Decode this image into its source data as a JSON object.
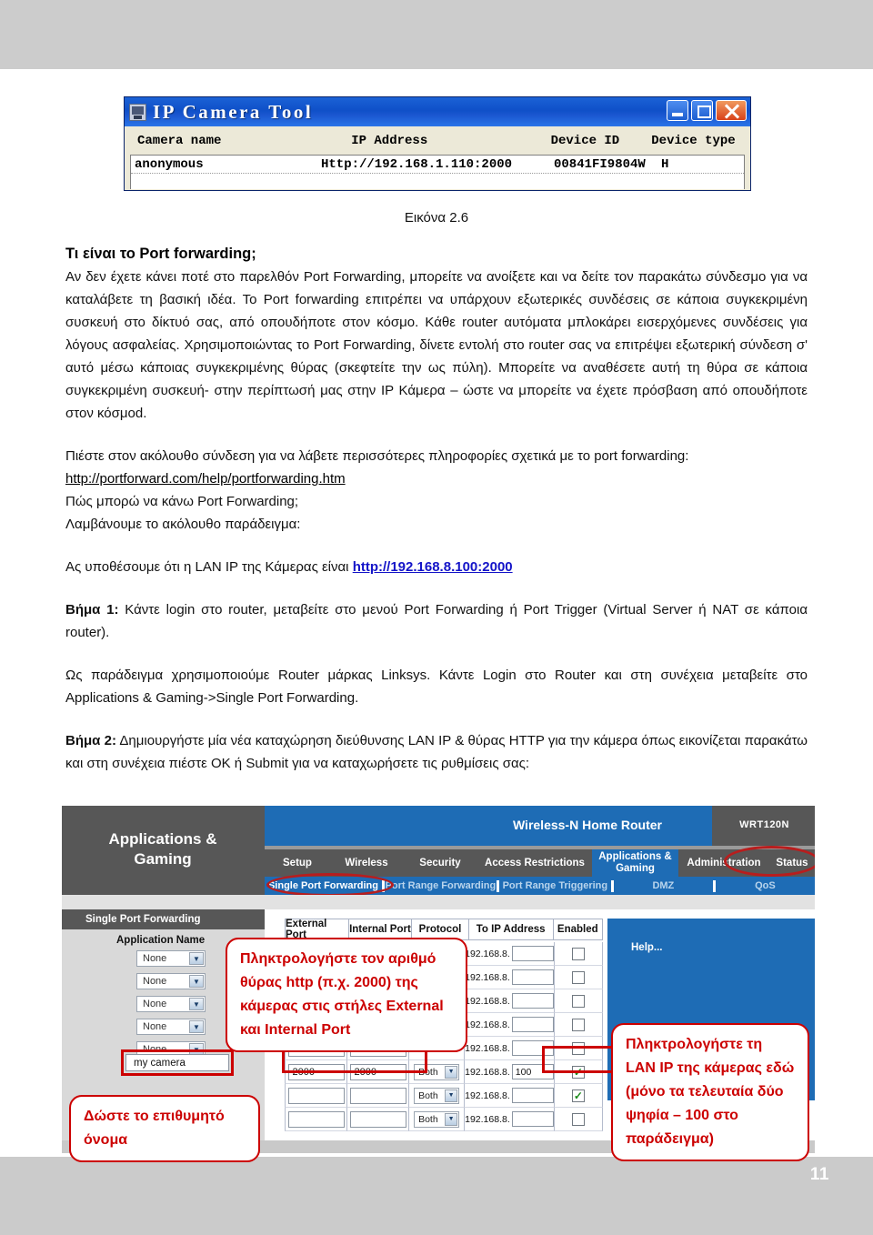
{
  "page": {
    "number": "11"
  },
  "ipcam_window": {
    "title": "IP Camera Tool",
    "app_icon": "camera-icon",
    "window_buttons": {
      "minimize": "minimize-icon",
      "maximize": "maximize-icon",
      "close": "close-icon"
    },
    "columns": [
      "Camera name",
      "IP Address",
      "Device ID",
      "Device type"
    ],
    "rows": [
      {
        "camera_name": "anonymous",
        "ip_address": "Http://192.168.1.110:2000",
        "device_id": "00841FI9804W",
        "device_type": "H"
      }
    ]
  },
  "caption": "Εικόνα 2.6",
  "body": {
    "heading": "Τι είναι το Port forwarding;",
    "paragraph1": "Αν δεν έχετε κάνει ποτέ στο παρελθόν Port Forwarding, μπορείτε να ανοίξετε και να δείτε τον παρακάτω σύνδεσμο για να καταλάβετε τη βασική ιδέα. Το Port forwarding επιτρέπει να υπάρχουν εξωτερικές συνδέσεις σε κάποια συγκεκριμένη συσκευή στο δίκτυό σας, από οπουδήποτε στον κόσμο. Κάθε router αυτόματα μπλοκάρει εισερχόμενες συνδέσεις για λόγους ασφαλείας. Χρησιμοποιώντας το Port Forwarding, δίνετε εντολή στο router σας να επιτρέψει εξωτερική σύνδεση σ' αυτό μέσω κάποιας συγκεκριμένης θύρας (σκεφτείτε την ως πύλη). Μπορείτε να αναθέσετε αυτή τη θύρα σε κάποια συγκεκριμένη συσκευή- στην περίπτωσή μας στην IP Κάμερα – ώστε να μπορείτε να έχετε πρόσβαση από οπουδήποτε στον κόσμοd.",
    "paragraph2": "Πιέστε στον ακόλουθο σύνδεση για να λάβετε περισσότερες πληροφορίες σχετικά με το port forwarding:",
    "link_portforward": "http://portforward.com/help/portforwarding.htm",
    "line_how": "Πώς μπορώ να κάνω Port Forwarding;",
    "line_example": "Λαμβάνουμε το ακόλουθο παράδειγμα:",
    "assume_prefix": "Ας υποθέσουμε ότι η LAN IP της Κάμερας είναι ",
    "assume_link": "http://192.168.8.100:2000",
    "step1_label": "Βήμα 1:",
    "step1_text": " Κάντε login στο router, μεταβείτε στο μενού Port Forwarding ή Port Trigger (Virtual Server ή NAT σε κάποια router).",
    "example_router": "Ως παράδειγμα χρησιμοποιούμε Router μάρκας Linksys. Κάντε Login στο Router και στη συνέχεια μεταβείτε στο Applications & Gaming->Single Port Forwarding.",
    "step2_label": "Βήμα 2:",
    "step2_text": " Δημιουργήστε μία νέα καταχώρηση διεύθυνσης LAN IP & θύρας HTTP για την κάμερα όπως εικονίζεται παρακάτω και στη συνέχεια πιέστε OK ή Submit για να καταχωρήσετε τις ρυθμίσεις σας:"
  },
  "router": {
    "section_title": "Applications &\nGaming",
    "section_title_line1": "Applications &",
    "section_title_line2": "Gaming",
    "brand_name": "Wireless-N Home Router",
    "model": "WRT120N",
    "nav": [
      "Setup",
      "Wireless",
      "Security",
      "Access Restrictions",
      "Applications & Gaming",
      "Administration",
      "Status"
    ],
    "nav_active_line1": "Applications &",
    "nav_active_line2": "Gaming",
    "subnav": [
      "Single Port Forwarding",
      "Port Range Forwarding",
      "Port Range Triggering",
      "DMZ",
      "QoS"
    ],
    "left_panel_title": "Single Port Forwarding",
    "application_name_label": "Application Name",
    "select_options": [
      "None",
      "None",
      "None",
      "None",
      "None"
    ],
    "application_name_value": "my camera",
    "help_label": "Help...",
    "table": {
      "headers": [
        "External Port",
        "Internal Port",
        "Protocol",
        "To IP Address",
        "Enabled"
      ],
      "ip_prefix": "192.168.8.",
      "rows": [
        {
          "external": "",
          "internal": "",
          "protocol": "",
          "ip_last": "",
          "enabled": false
        },
        {
          "external": "",
          "internal": "",
          "protocol": "",
          "ip_last": "",
          "enabled": false
        },
        {
          "external": "",
          "internal": "",
          "protocol": "",
          "ip_last": "",
          "enabled": false
        },
        {
          "external": "",
          "internal": "",
          "protocol": "",
          "ip_last": "",
          "enabled": false
        },
        {
          "external": "",
          "internal": "",
          "protocol": "",
          "ip_last": "",
          "enabled": false
        },
        {
          "external": "2000",
          "internal": "2000",
          "protocol": "Both",
          "ip_last": "100",
          "enabled": true
        },
        {
          "external": "",
          "internal": "",
          "protocol": "Both",
          "ip_last": "",
          "enabled": true
        },
        {
          "external": "",
          "internal": "",
          "protocol": "Both",
          "ip_last": "",
          "enabled": false
        }
      ]
    }
  },
  "callouts": {
    "ports": "Πληκτρολογήστε τον αριθμό θύρας http (π.χ. 2000) της κάμερας στις στήλες External και Internal Port",
    "name": "Δώστε το επιθυμητό όνομα",
    "lanip": "Πληκτρολογήστε τη LAN IP της κάμερας εδώ (μόνο τα τελευταία δύο ψηφία – 100 στο παράδειγμα)"
  },
  "colors": {
    "band_gray": "#cccccc",
    "accent_red": "#cc0000",
    "router_blue": "#1e6cb5",
    "router_dark": "#575757",
    "title_blue": "#0f50c8",
    "link_blue": "#1414c8"
  }
}
